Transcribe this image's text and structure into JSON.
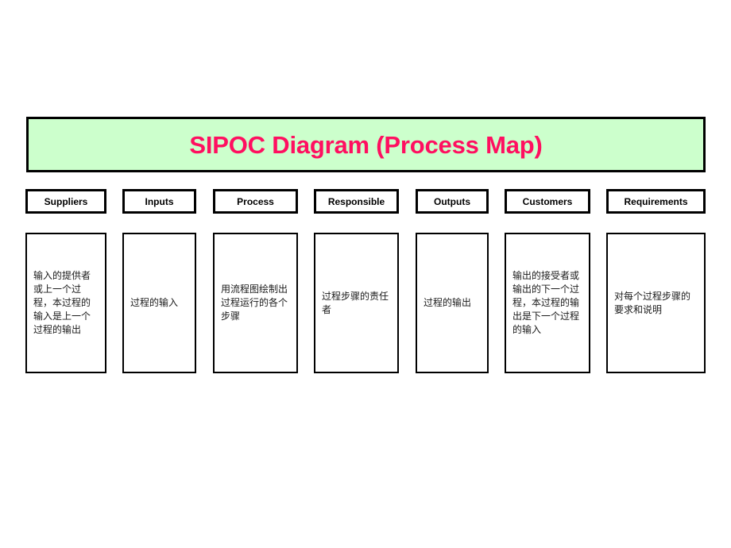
{
  "title": {
    "text": "SIPOC Diagram (Process Map)",
    "background_color": "#ccffcc",
    "text_color": "#ff0f60",
    "border_color": "#000000"
  },
  "columns": [
    {
      "header": "Suppliers",
      "body": "输入的提供者或上一个过程，本过程的输入是上一个过程的输出"
    },
    {
      "header": "Inputs",
      "body": "过程的输入"
    },
    {
      "header": "Process",
      "body": "用流程图绘制出过程运行的各个步骤"
    },
    {
      "header": "Responsible",
      "body": "过程步骤的责任者"
    },
    {
      "header": "Outputs",
      "body": "过程的输出"
    },
    {
      "header": "Customers",
      "body": "输出的接受者或输出的下一个过程，本过程的输出是下一个过程的输入"
    },
    {
      "header": "Requirements",
      "body": "对每个过程步骤的要求和说明"
    }
  ]
}
